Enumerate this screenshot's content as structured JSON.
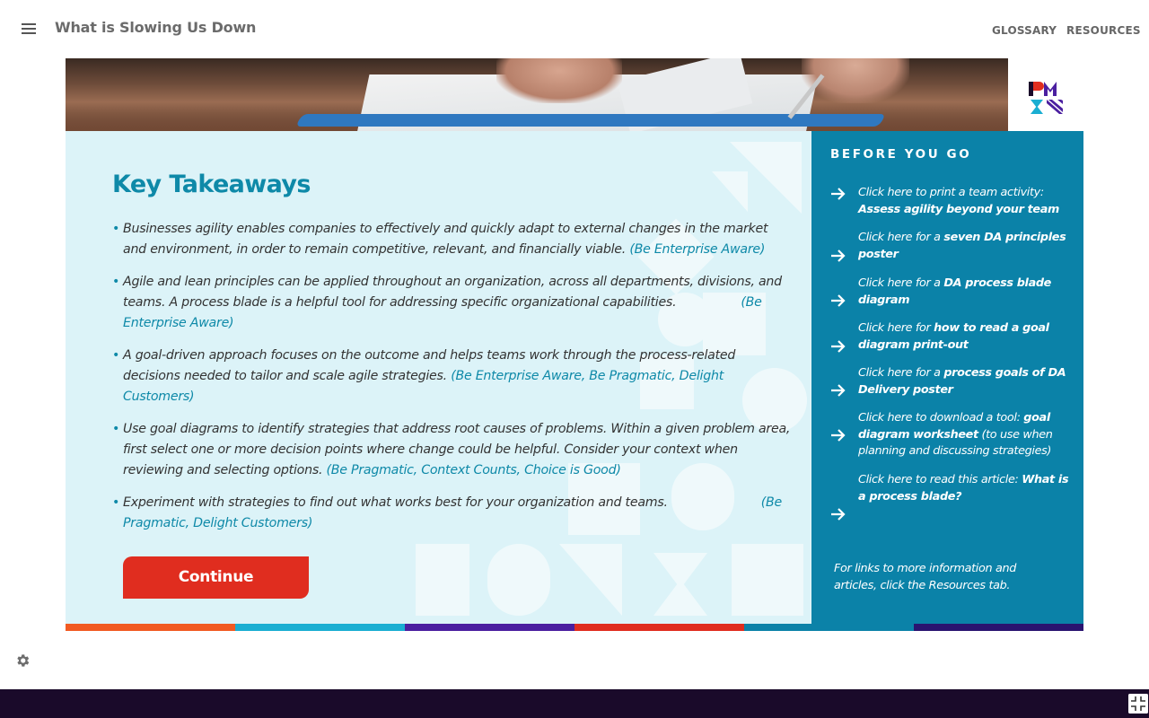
{
  "header": {
    "title": "What is Slowing Us Down",
    "nav": {
      "glossary": "GLOSSARY",
      "resources": "RESOURCES"
    }
  },
  "main": {
    "heading": "Key Takeaways",
    "takeaways": [
      {
        "text": "Businesses agility enables companies to effectively and quickly adapt to external changes in the market and environment, in order to remain competitive, relevant, and financially viable. ",
        "ref": "(Be Enterprise Aware)"
      },
      {
        "text": "Agile and lean principles can be applied throughout an organization, across all departments, divisions, and teams. A process blade is a helpful tool for addressing specific organizational capabilities.",
        "ref": "(Be Enterprise Aware)"
      },
      {
        "text": "A goal-driven approach focuses on the outcome and helps teams work through the process-related decisions needed to tailor and scale agile strategies. ",
        "ref": "(Be Enterprise Aware, Be Pragmatic, Delight Customers)"
      },
      {
        "text": "Use goal diagrams to identify strategies that address root causes of problems. Within a given problem area, first select one or more decision points where change could be helpful. Consider your context when reviewing and selecting options. ",
        "ref": "(Be Pragmatic, Context Counts, Choice is Good)"
      },
      {
        "text": "Experiment with strategies to find out what works best for your organization and teams.",
        "ref": "(Be Pragmatic, Delight Customers)"
      }
    ],
    "continue_label": "Continue"
  },
  "sidebar": {
    "heading": "BEFORE YOU GO",
    "links": [
      {
        "prefix": "Click here to print a team activity: ",
        "bold": "Assess agility beyond your team",
        "suffix": ""
      },
      {
        "prefix": "Click here for a ",
        "bold": "seven DA principles poster",
        "suffix": ""
      },
      {
        "prefix": "Click here for a ",
        "bold": "DA process blade diagram",
        "suffix": ""
      },
      {
        "prefix": "Click here for ",
        "bold": "how to read a goal diagram print-out",
        "suffix": ""
      },
      {
        "prefix": "Click here for a ",
        "bold": "process goals of DA Delivery poster",
        "suffix": ""
      },
      {
        "prefix": "Click here to download a tool: ",
        "bold": "goal diagram worksheet",
        "suffix": " (to use when planning and discussing strategies)"
      },
      {
        "prefix": "Click here to read this article: ",
        "bold": "What is a process blade?",
        "suffix": ""
      }
    ],
    "note": "For links to more information and articles, click the Resources tab."
  },
  "colors": {
    "accent_teal": "#0e89a8",
    "panel_light": "#dcf3f8",
    "sidebar_bg": "#0b82a8",
    "continue_red": "#e02d1f",
    "bottom_bar": "#1a0a2a",
    "color_bar": [
      "#f15a22",
      "#1aaed2",
      "#4b1fa0",
      "#e02d1f",
      "#0b82a8",
      "#2a1470"
    ]
  },
  "icons": {
    "menu": "hamburger-menu-icon",
    "logo": "pmi-logo",
    "arrow": "arrow-right-icon",
    "settings": "gear-icon",
    "fullscreen": "exit-fullscreen-icon"
  }
}
